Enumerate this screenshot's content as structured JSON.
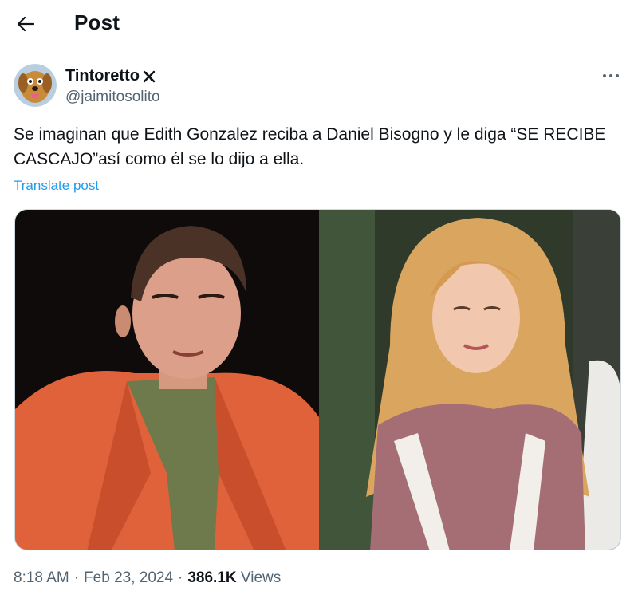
{
  "header": {
    "title": "Post"
  },
  "author": {
    "display_name": "Tintoretto",
    "handle": "@jaimitosolito"
  },
  "post": {
    "text": "Se imaginan que Edith Gonzalez reciba a Daniel Bisogno y le diga “SE RECIBE CASCAJO”así como él se lo dijo a ella.",
    "translate_label": "Translate post"
  },
  "meta": {
    "time": "8:18 AM",
    "sep1": "·",
    "date": "Feb 23, 2024",
    "sep2": "·",
    "views_count": "386.1K",
    "views_label": "Views"
  },
  "icons": {
    "back": "arrow-left-icon",
    "badge": "x-logo-icon",
    "more": "more-dots-icon"
  },
  "colors": {
    "link": "#1d9bf0",
    "secondary_text": "#536471",
    "primary_text": "#0f1419"
  }
}
